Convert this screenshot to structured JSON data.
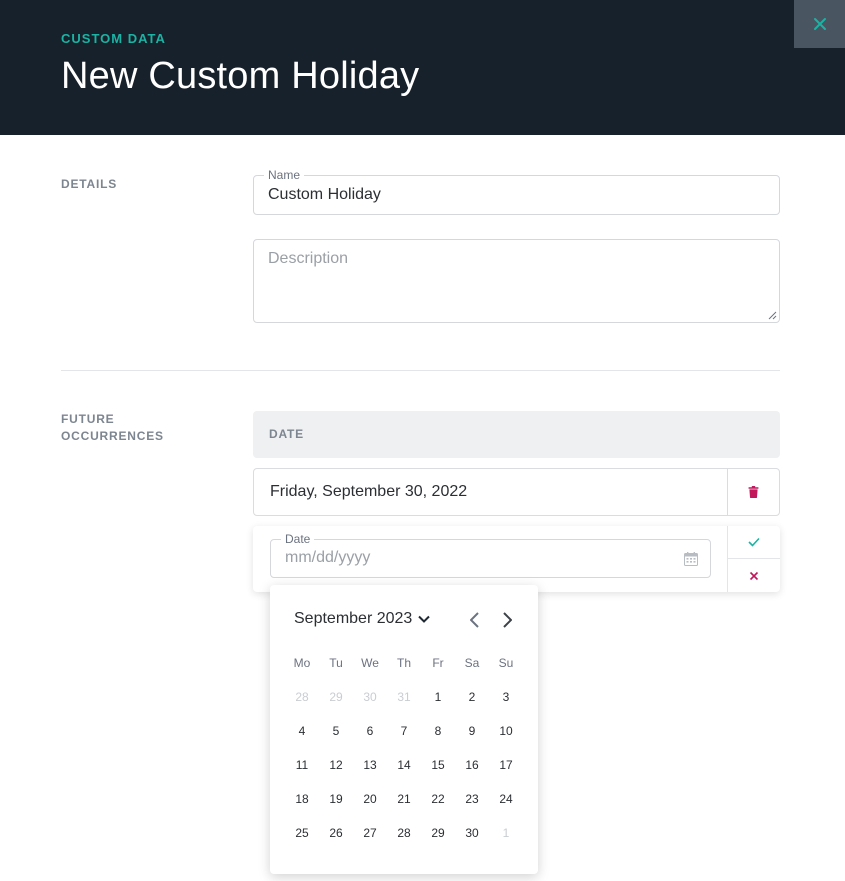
{
  "header": {
    "eyebrow": "CUSTOM DATA",
    "title": "New Custom Holiday",
    "close_icon": "close-icon",
    "accent": "#1bb3a3",
    "background": "#17212b"
  },
  "details": {
    "label": "DETAILS",
    "name_legend": "Name",
    "name_value": "Custom Holiday",
    "description_placeholder": "Description"
  },
  "occurrences": {
    "label_line1": "FUTURE",
    "label_line2": "OCCURRENCES",
    "column_header": "DATE",
    "rows": [
      {
        "date": "Friday, September 30, 2022",
        "action_icon": "trash-icon"
      }
    ],
    "new_entry": {
      "legend": "Date",
      "placeholder": "mm/dd/yyyy",
      "calendar_icon": "calendar-icon",
      "confirm_icon": "check-icon",
      "cancel_icon": "close-icon"
    }
  },
  "calendar": {
    "month_label": "September 2023",
    "weekdays": [
      "Mo",
      "Tu",
      "We",
      "Th",
      "Fr",
      "Sa",
      "Su"
    ],
    "weeks": [
      [
        {
          "d": "28",
          "other": true
        },
        {
          "d": "29",
          "other": true
        },
        {
          "d": "30",
          "other": true
        },
        {
          "d": "31",
          "other": true
        },
        {
          "d": "1"
        },
        {
          "d": "2"
        },
        {
          "d": "3"
        }
      ],
      [
        {
          "d": "4"
        },
        {
          "d": "5"
        },
        {
          "d": "6"
        },
        {
          "d": "7"
        },
        {
          "d": "8"
        },
        {
          "d": "9"
        },
        {
          "d": "10"
        }
      ],
      [
        {
          "d": "11"
        },
        {
          "d": "12"
        },
        {
          "d": "13"
        },
        {
          "d": "14"
        },
        {
          "d": "15"
        },
        {
          "d": "16"
        },
        {
          "d": "17"
        }
      ],
      [
        {
          "d": "18"
        },
        {
          "d": "19"
        },
        {
          "d": "20"
        },
        {
          "d": "21"
        },
        {
          "d": "22"
        },
        {
          "d": "23"
        },
        {
          "d": "24"
        }
      ],
      [
        {
          "d": "25"
        },
        {
          "d": "26"
        },
        {
          "d": "27"
        },
        {
          "d": "28"
        },
        {
          "d": "29"
        },
        {
          "d": "30"
        },
        {
          "d": "1",
          "other": true
        }
      ]
    ]
  }
}
